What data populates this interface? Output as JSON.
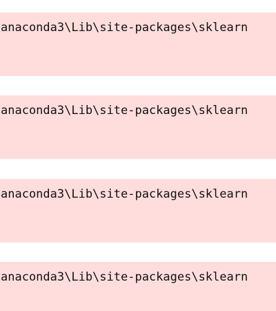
{
  "output_blocks": [
    {
      "text": "anaconda3\\Lib\\site-packages\\sklearn"
    },
    {
      "text": "anaconda3\\Lib\\site-packages\\sklearn"
    },
    {
      "text": "anaconda3\\Lib\\site-packages\\sklearn"
    },
    {
      "text": "anaconda3\\Lib\\site-packages\\sklearn"
    }
  ],
  "colors": {
    "stderr_background": "#ffdddd",
    "page_background": "#ffffff",
    "text": "#111111"
  }
}
